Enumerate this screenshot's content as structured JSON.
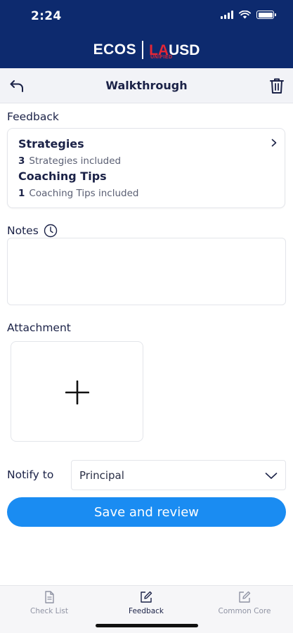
{
  "status_bar": {
    "time": "2:24"
  },
  "brand": {
    "left": "ECOS",
    "la": "LA",
    "usd": "USD",
    "sub": "UNIFIED",
    "accent": "#e32636",
    "bg": "#0d2a6e"
  },
  "navbar": {
    "title": "Walkthrough",
    "back_icon": "undo-arrow-icon",
    "delete_icon": "trash-icon"
  },
  "feedback": {
    "label": "Feedback",
    "strategies_title": "Strategies",
    "strategies_count": "3",
    "strategies_text": "Strategies included",
    "tips_title": "Coaching Tips",
    "tips_count": "1",
    "tips_text": "Coaching Tips included"
  },
  "notes": {
    "label": "Notes",
    "value": ""
  },
  "attachment": {
    "label": "Attachment"
  },
  "notify": {
    "label": "Notify to",
    "selected": "Principal"
  },
  "save_button": {
    "label": "Save and review",
    "color": "#1a8cf2"
  },
  "tabs": [
    {
      "label": "Check List",
      "icon": "document-icon",
      "active": false
    },
    {
      "label": "Feedback",
      "icon": "edit-icon",
      "active": true
    },
    {
      "label": "Common Core",
      "icon": "edit-icon",
      "active": false
    }
  ]
}
